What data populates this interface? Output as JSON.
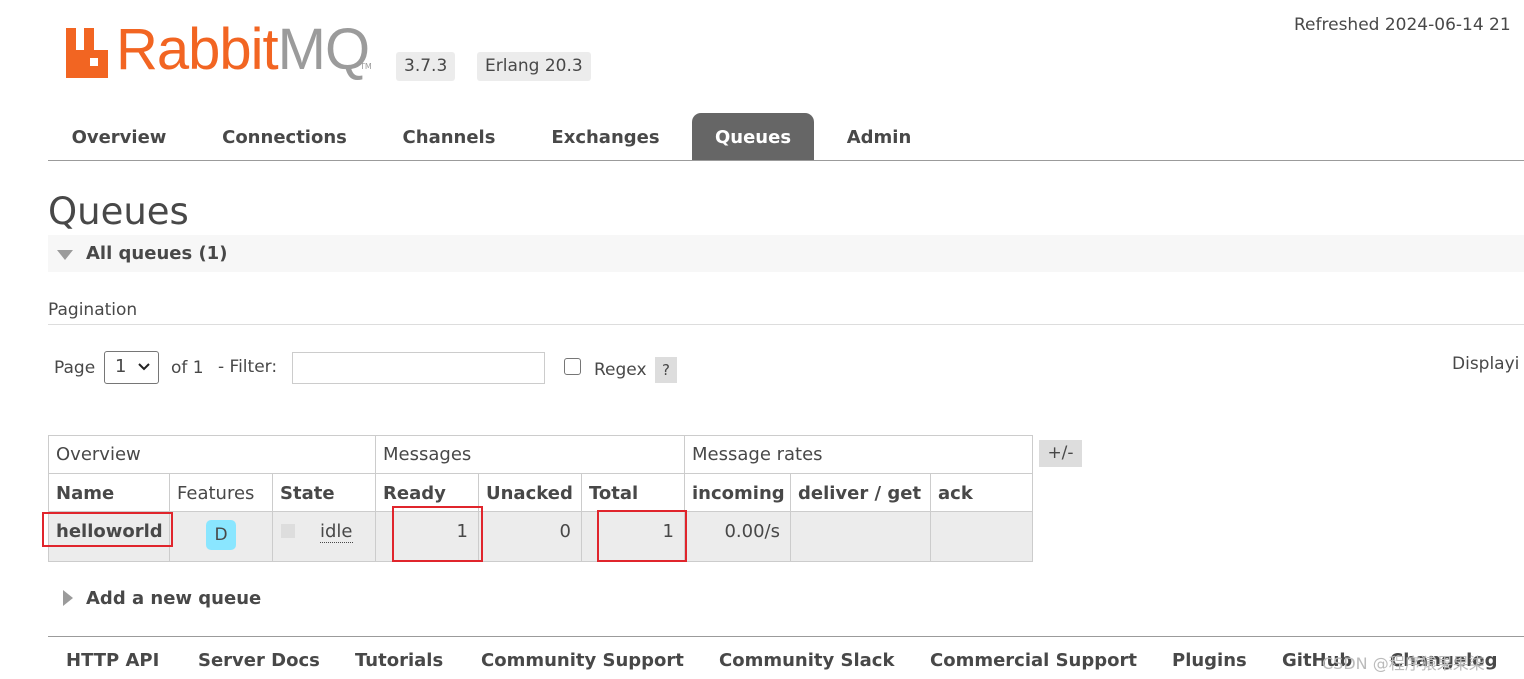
{
  "header": {
    "logo_text_rabbit": "Rabbit",
    "logo_text_mq": "MQ",
    "logo_tm": "TM",
    "version": "3.7.3",
    "erlang": "Erlang 20.3",
    "refreshed": "Refreshed 2024-06-14 21"
  },
  "tabs": [
    {
      "label": "Overview"
    },
    {
      "label": "Connections"
    },
    {
      "label": "Channels"
    },
    {
      "label": "Exchanges"
    },
    {
      "label": "Queues",
      "active": true
    },
    {
      "label": "Admin"
    }
  ],
  "page": {
    "title": "Queues",
    "section_label": "All queues (1)"
  },
  "pagination": {
    "label": "Pagination",
    "page_label": "Page",
    "page_value": "1",
    "of_label": "of 1",
    "filter_label": "- Filter:",
    "filter_value": "",
    "regex_label": "Regex",
    "regex_checked": false,
    "help": "?",
    "displaying": "Displayi"
  },
  "table": {
    "group_headers": [
      "Overview",
      "Messages",
      "Message rates"
    ],
    "columns": [
      "Name",
      "Features",
      "State",
      "Ready",
      "Unacked",
      "Total",
      "incoming",
      "deliver / get",
      "ack"
    ],
    "plus_minus": "+/-",
    "rows": [
      {
        "name": "helloworld",
        "feature": "D",
        "state": "idle",
        "ready": "1",
        "unacked": "0",
        "total": "1",
        "incoming": "0.00/s",
        "deliver_get": "",
        "ack": ""
      }
    ]
  },
  "add_queue": "Add a new queue",
  "footer": {
    "links": [
      "HTTP API",
      "Server Docs",
      "Tutorials",
      "Community Support",
      "Community Slack",
      "Commercial Support",
      "Plugins",
      "GitHub",
      "Changelog"
    ],
    "watermark": "CSDN @程序猿果果柒"
  },
  "colors": {
    "brand_orange": "#f26522",
    "active_tab": "#666666",
    "feature_badge": "#8ae6ff",
    "highlight_red": "#e0252c"
  }
}
